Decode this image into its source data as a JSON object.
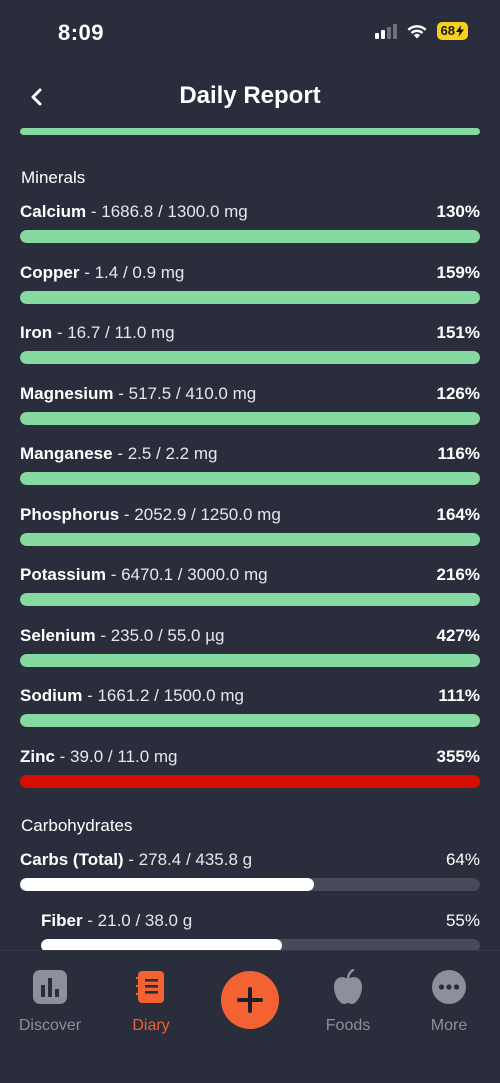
{
  "status": {
    "time": "8:09",
    "battery": "68"
  },
  "header": {
    "title": "Daily Report"
  },
  "sections": {
    "minerals": "Minerals",
    "carbs": "Carbohydrates"
  },
  "minerals": [
    {
      "name": "Calcium",
      "amount": " - 1686.8 / 1300.0 mg",
      "percent": "130%",
      "fill": 1.0,
      "color": "#86d9a1"
    },
    {
      "name": "Copper",
      "amount": " - 1.4 / 0.9 mg",
      "percent": "159%",
      "fill": 1.0,
      "color": "#86d9a1"
    },
    {
      "name": "Iron",
      "amount": " - 16.7 / 11.0 mg",
      "percent": "151%",
      "fill": 1.0,
      "color": "#86d9a1"
    },
    {
      "name": "Magnesium",
      "amount": " - 517.5 / 410.0 mg",
      "percent": "126%",
      "fill": 1.0,
      "color": "#86d9a1"
    },
    {
      "name": "Manganese",
      "amount": " - 2.5 / 2.2 mg",
      "percent": "116%",
      "fill": 1.0,
      "color": "#86d9a1"
    },
    {
      "name": "Phosphorus",
      "amount": " - 2052.9 / 1250.0 mg",
      "percent": "164%",
      "fill": 1.0,
      "color": "#86d9a1"
    },
    {
      "name": "Potassium",
      "amount": " - 6470.1 / 3000.0 mg",
      "percent": "216%",
      "fill": 1.0,
      "color": "#86d9a1"
    },
    {
      "name": "Selenium",
      "amount": " - 235.0 / 55.0 µg",
      "percent": "427%",
      "fill": 1.0,
      "color": "#86d9a1"
    },
    {
      "name": "Sodium",
      "amount": " - 1661.2 / 1500.0 mg",
      "percent": "111%",
      "fill": 1.0,
      "color": "#86d9a1"
    },
    {
      "name": "Zinc",
      "amount": " - 39.0 / 11.0 mg",
      "percent": "355%",
      "fill": 1.0,
      "color": "#d40f00"
    }
  ],
  "carbohydrates": [
    {
      "name": "Carbs (Total)",
      "amount": " - 278.4 / 435.8 g",
      "percent": "64%",
      "fill": 0.64,
      "color": "#ffffff"
    },
    {
      "name": "Fiber",
      "amount": " - 21.0 / 38.0 g",
      "percent": "55%",
      "fill": 0.55,
      "color": "#ffffff"
    }
  ],
  "tabs": {
    "discover": "Discover",
    "diary": "Diary",
    "foods": "Foods",
    "more": "More"
  },
  "colors": {
    "accent": "#f26233",
    "background": "#2a2d3b",
    "good": "#86d9a1",
    "over": "#d40f00"
  },
  "icons": [
    "back-chevron-icon",
    "bar-chart-icon",
    "notebook-icon",
    "plus-icon",
    "apple-icon",
    "more-dots-icon"
  ]
}
